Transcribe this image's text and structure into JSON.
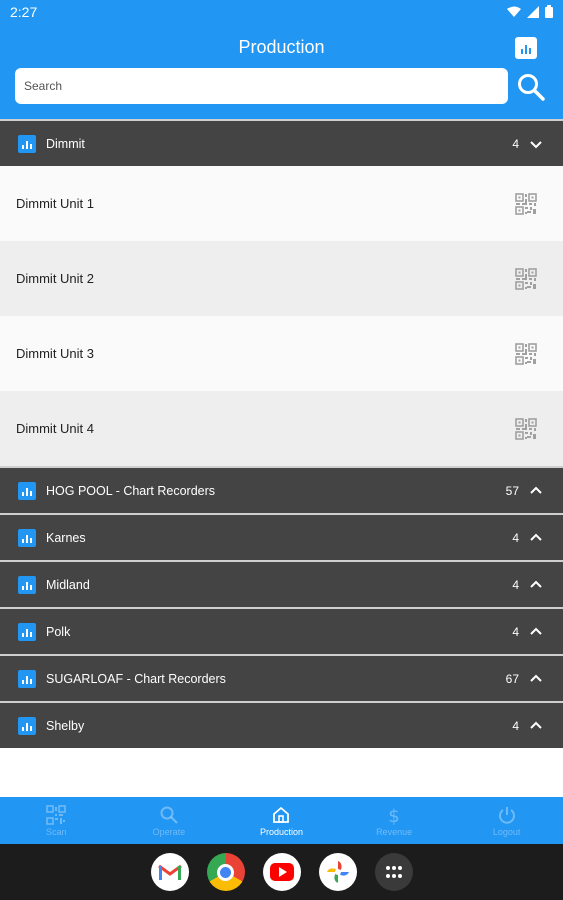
{
  "status_bar": {
    "time": "2:27"
  },
  "header": {
    "title": "Production"
  },
  "search": {
    "placeholder": "Search",
    "value": ""
  },
  "groups": [
    {
      "name": "Dimmit",
      "count": "4",
      "expanded": true
    },
    {
      "name": "HOG POOL - Chart Recorders",
      "count": "57",
      "expanded": false
    },
    {
      "name": "Karnes",
      "count": "4",
      "expanded": false
    },
    {
      "name": "Midland",
      "count": "4",
      "expanded": false
    },
    {
      "name": "Polk",
      "count": "4",
      "expanded": false
    },
    {
      "name": "SUGARLOAF - Chart Recorders",
      "count": "67",
      "expanded": false
    },
    {
      "name": "Shelby",
      "count": "4",
      "expanded": false
    }
  ],
  "dimmit_units": [
    "Dimmit Unit 1",
    "Dimmit Unit 2",
    "Dimmit Unit 3",
    "Dimmit Unit 4"
  ],
  "bottom_nav": [
    {
      "label": "Scan",
      "icon": "qr-code-icon",
      "active": false
    },
    {
      "label": "Operate",
      "icon": "search-icon",
      "active": false
    },
    {
      "label": "Production",
      "icon": "home-icon",
      "active": true
    },
    {
      "label": "Revenue",
      "icon": "dollar-icon",
      "active": false
    },
    {
      "label": "Logout",
      "icon": "power-icon",
      "active": false
    }
  ],
  "dock": [
    "gmail-app-icon",
    "chrome-app-icon",
    "youtube-app-icon",
    "photos-app-icon",
    "app-drawer-icon"
  ],
  "colors": {
    "primary": "#2196f3",
    "group_header": "#444444",
    "taskbar": "#1c1c1c"
  }
}
